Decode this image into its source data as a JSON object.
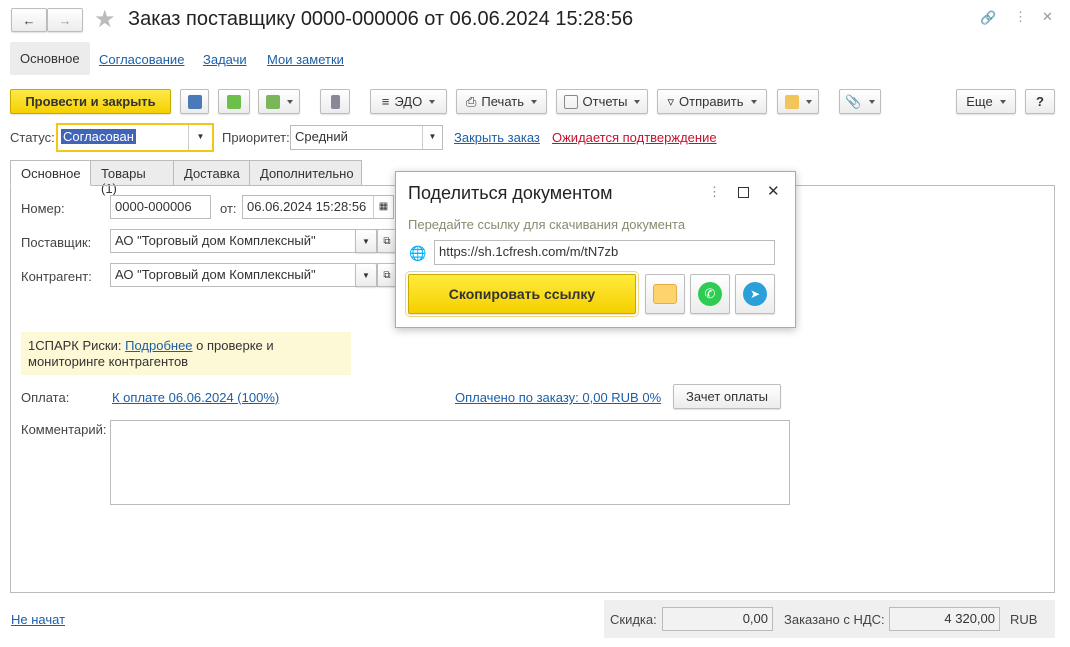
{
  "header": {
    "title": "Заказ поставщику 0000-000006 от 06.06.2024 15:28:56"
  },
  "nav_tabs": [
    "Основное",
    "Согласование",
    "Задачи",
    "Мои заметки"
  ],
  "toolbar": {
    "post_close": "Провести и закрыть",
    "edo": "ЭДО",
    "print": "Печать",
    "reports": "Отчеты",
    "send": "Отправить",
    "more": "Еще",
    "help": "?"
  },
  "status": {
    "label": "Статус:",
    "value": "Согласован",
    "priority_label": "Приоритет:",
    "priority_value": "Средний",
    "close_order": "Закрыть заказ",
    "awaiting": "Ожидается подтверждение"
  },
  "form_tabs": [
    "Основное",
    "Товары (1)",
    "Доставка",
    "Дополнительно"
  ],
  "form": {
    "number_label": "Номер:",
    "number": "0000-000006",
    "from_label": "от:",
    "date": "06.06.2024 15:28:56",
    "supplier_label": "Поставщик:",
    "supplier": "АО \"Торговый дом Комплексный\"",
    "counterparty_label": "Контрагент:",
    "counterparty": "АО \"Торговый дом Комплексный\"",
    "spark_prefix": "1СПАРК Риски:",
    "spark_link": "Подробнее",
    "spark_rest": "о проверке и мониторинге контрагентов",
    "payment_label": "Оплата:",
    "payment_link": "К оплате 06.06.2024 (100%)",
    "paid_link": "Оплачено по заказу: 0,00 RUB 0%",
    "offset_btn": "Зачет оплаты",
    "comment_label": "Комментарий:",
    "comment": ""
  },
  "footer": {
    "state": "Не начат",
    "discount_label": "Скидка:",
    "discount": "0,00",
    "ordered_label": "Заказано с НДС:",
    "ordered": "4 320,00",
    "currency": "RUB"
  },
  "popup": {
    "title": "Поделиться документом",
    "hint": "Передайте ссылку для скачивания документа",
    "url": "https://sh.1cfresh.com/m/tN7zb",
    "copy": "Скопировать ссылку"
  }
}
